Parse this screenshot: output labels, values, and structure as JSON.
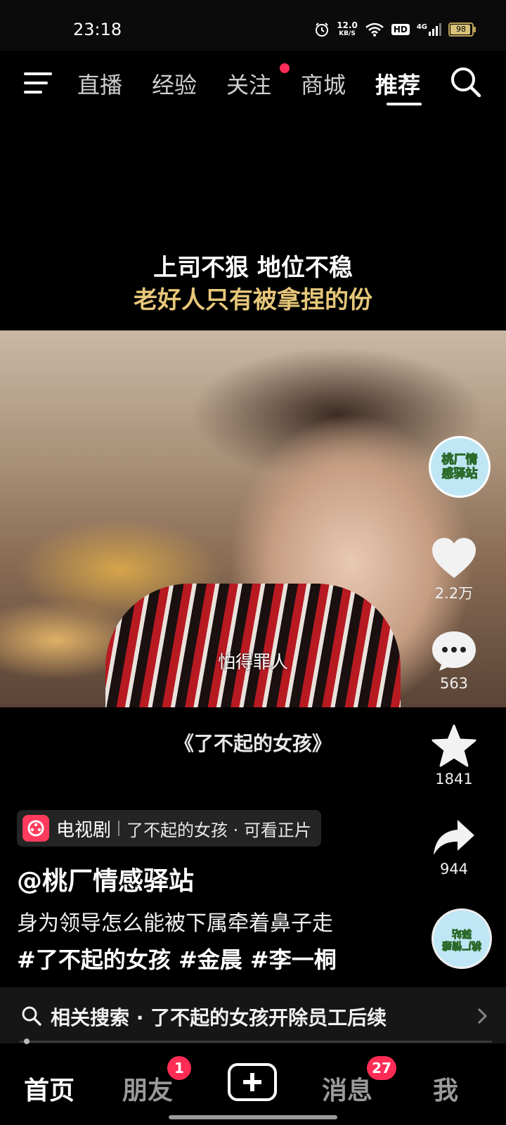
{
  "status_bar": {
    "time": "23:18",
    "net_speed_value": "12.0",
    "net_speed_unit": "KB/S",
    "hd_label": "HD",
    "signal_label": "4G",
    "battery": "98"
  },
  "top_nav": {
    "tabs": [
      {
        "label": "直播"
      },
      {
        "label": "经验"
      },
      {
        "label": "关注"
      },
      {
        "label": "商城"
      },
      {
        "label": "推荐"
      }
    ],
    "active_tab": "推荐"
  },
  "video": {
    "caption_line1": "上司不狠 地位不稳",
    "caption_line2": "老好人只有被拿捏的份",
    "subtitle": "怕得罪人",
    "drama_title": "《了不起的女孩》"
  },
  "actions": {
    "avatar_text": "桃厂情感驿站",
    "likes": "2.2万",
    "comments": "563",
    "favorites": "1841",
    "shares": "944"
  },
  "info": {
    "tag_type": "电视剧",
    "tag_info": "了不起的女孩 · 可看正片",
    "author": "@桃厂情感驿站",
    "description": "身为领导怎么能被下属牵着鼻子走",
    "hashtags": "#了不起的女孩 #金晨 #李一桐",
    "music_disc_text": "桃厂情感驿站"
  },
  "related_search": {
    "text": "相关搜索 · 了不起的女孩开除员工后续"
  },
  "tab_bar": {
    "home": "首页",
    "friends": "朋友",
    "friends_badge": "1",
    "messages": "消息",
    "messages_badge": "27",
    "me": "我"
  },
  "colors": {
    "accent_red": "#ff2c55",
    "caption_gold": "#e7c77a"
  }
}
